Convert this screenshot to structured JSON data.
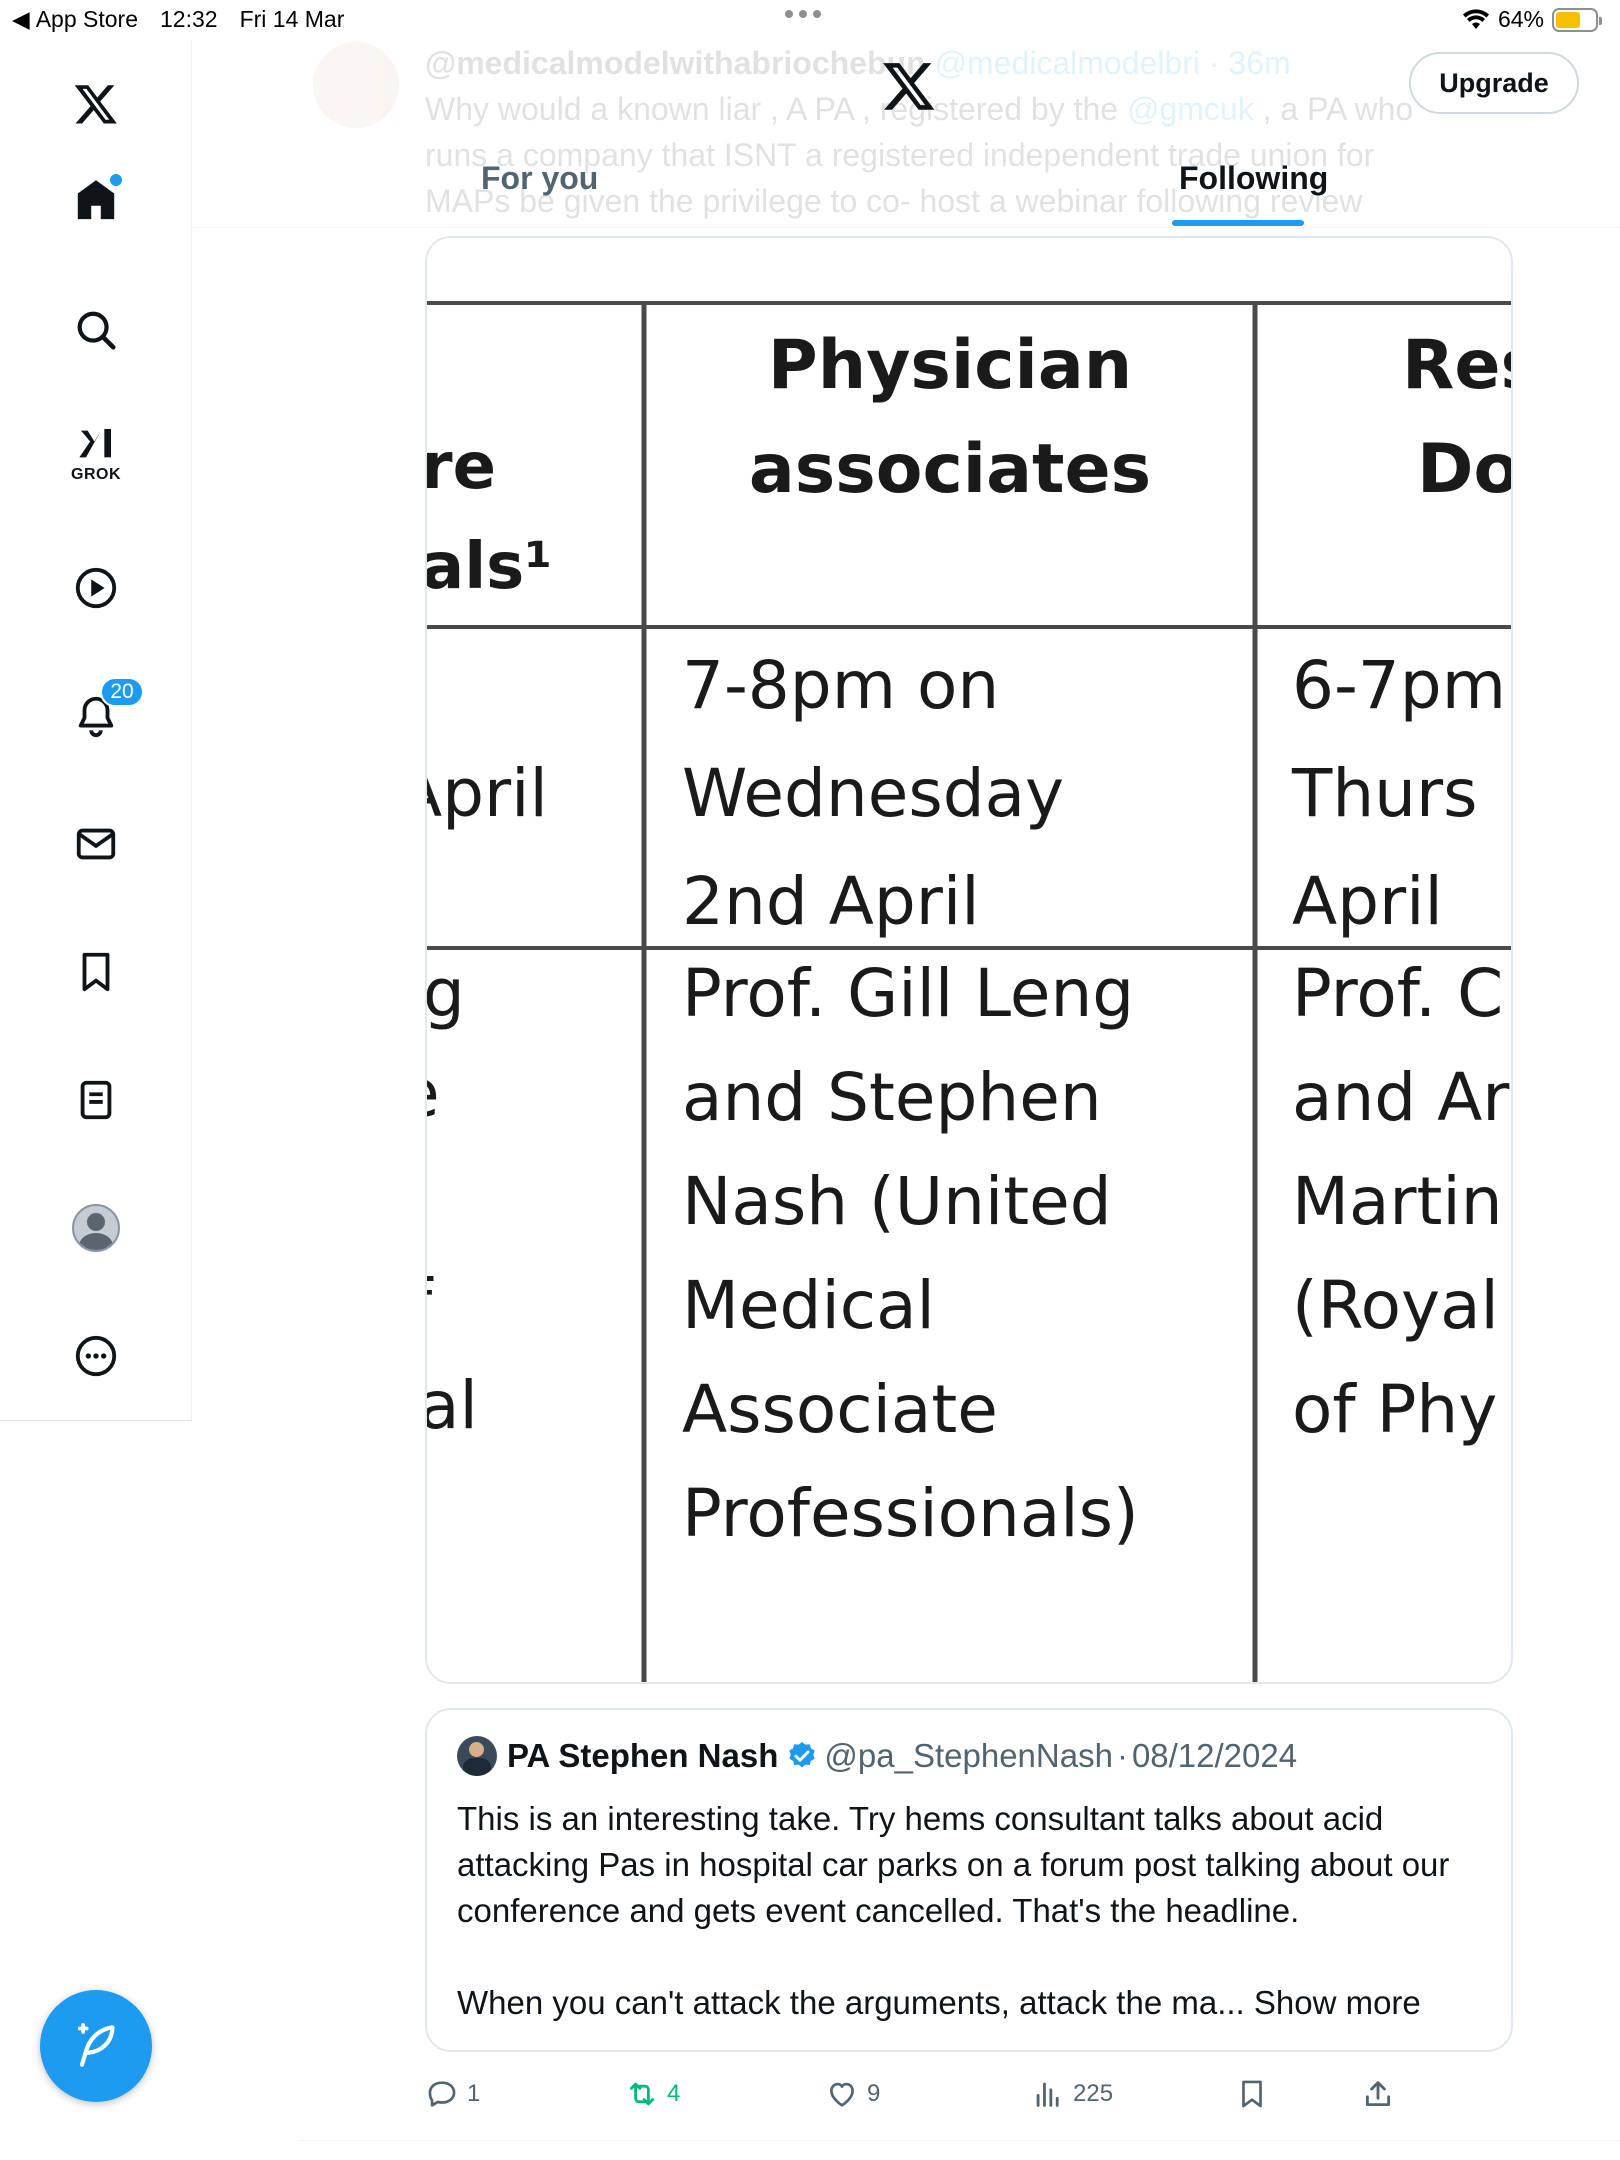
{
  "status_bar": {
    "back_label": "App Store",
    "time": "12:32",
    "date": "Fri 14 Mar",
    "battery": "64%",
    "battery_color": "#f5c000"
  },
  "nav": {
    "items": [
      {
        "name": "home-icon",
        "has_dot": true
      },
      {
        "name": "search-icon"
      },
      {
        "name": "grok-icon",
        "label": "GROK"
      },
      {
        "name": "video-icon"
      },
      {
        "name": "notifications-icon",
        "badge": "20"
      },
      {
        "name": "messages-icon"
      },
      {
        "name": "bookmarks-icon"
      },
      {
        "name": "lists-icon"
      },
      {
        "name": "profile-avatar"
      },
      {
        "name": "more-icon"
      }
    ],
    "compose_icon": "compose-icon"
  },
  "header": {
    "upgrade": "Upgrade",
    "tabs": [
      {
        "label": "For you",
        "active": false
      },
      {
        "label": "Following",
        "active": true
      }
    ],
    "ghost_tweet": {
      "name": "@medicalmodelwithabriochebun",
      "handle": "@medicalmodelbri",
      "time": "· 36m",
      "line1_a": "Why would a known liar , A PA , registered by the ",
      "mention": "@gmcuk",
      "line1_b": " , a PA who",
      "line2": "runs a company that ISNT a registered independent trade union for",
      "line3": "MAPs be given the privilege to co- host a webinar following review"
    }
  },
  "media_table": {
    "col1_partial": [
      "re",
      "als¹",
      "April",
      "ng",
      "e",
      "f",
      "al"
    ],
    "col2_header": [
      "Physician",
      "associates"
    ],
    "col2_row1": [
      "7-8pm on",
      "Wednesday",
      "2nd April"
    ],
    "col2_row2": [
      "Prof. Gill Leng",
      "and Stephen",
      "Nash (United",
      "Medical",
      "Associate",
      "Professionals)"
    ],
    "col3_header": [
      "Res",
      "Do"
    ],
    "col3_row1": [
      "6-7pm",
      "Thurs",
      "April"
    ],
    "col3_row2": [
      "Prof. C",
      "and Ar",
      "Martin",
      "(Royal",
      "of Phy"
    ]
  },
  "quote": {
    "name": "PA Stephen Nash",
    "handle": "@pa_StephenNash",
    "sep": "·",
    "date": "08/12/2024",
    "paragraph1": "This is an interesting take. Try hems consultant talks about acid attacking Pas in hospital car parks on a forum post talking about our conference and gets event cancelled. That's the headline.",
    "paragraph2": "When you can't attack the arguments, attack the ma...",
    "show_more": "Show more",
    "verified_color": "#1d9bf0"
  },
  "actions": {
    "replies": "1",
    "reposts": "4",
    "likes": "9",
    "views": "225",
    "repost_color": "#00ba7c"
  }
}
